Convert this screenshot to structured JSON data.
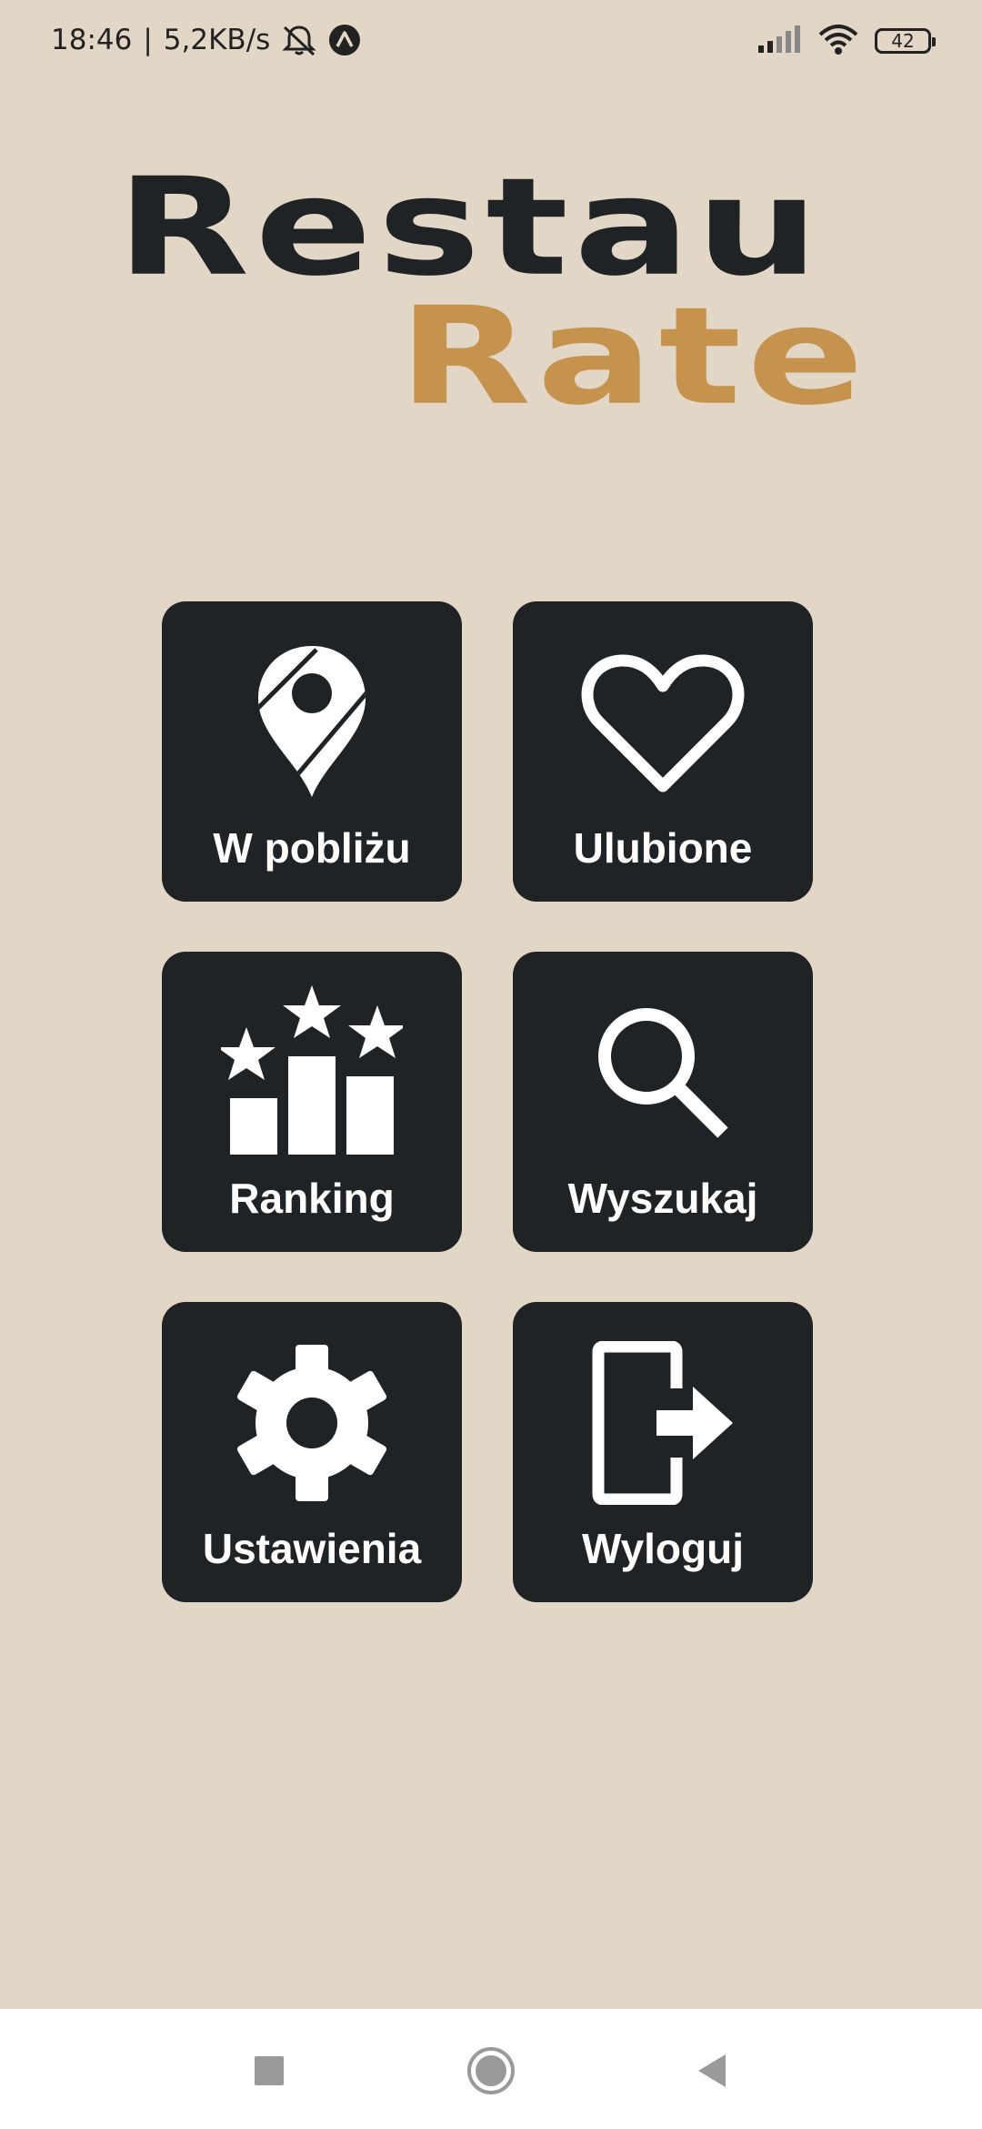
{
  "status_bar": {
    "time": "18:46",
    "separator": "|",
    "speed": "5,2KB/s",
    "battery": "42",
    "icons": [
      "mute-icon",
      "notification-icon",
      "signal-icon",
      "wifi-icon",
      "battery-icon"
    ]
  },
  "logo": {
    "line1": "Restau",
    "line2": "Rate"
  },
  "menu": {
    "nearby": {
      "label": "W pobliżu",
      "icon": "map-pin-icon"
    },
    "favorites": {
      "label": "Ulubione",
      "icon": "heart-icon"
    },
    "ranking": {
      "label": "Ranking",
      "icon": "ranking-stars-icon"
    },
    "search": {
      "label": "Wyszukaj",
      "icon": "search-icon"
    },
    "settings": {
      "label": "Ustawienia",
      "icon": "gear-icon"
    },
    "logout": {
      "label": "Wyloguj",
      "icon": "logout-icon"
    }
  },
  "colors": {
    "background": "#e2d6c7",
    "tile": "#202326",
    "logo_dark": "#202326",
    "logo_accent": "#c6934f"
  },
  "nav_bar": {
    "buttons": [
      "recents-icon",
      "home-icon",
      "back-icon"
    ]
  }
}
